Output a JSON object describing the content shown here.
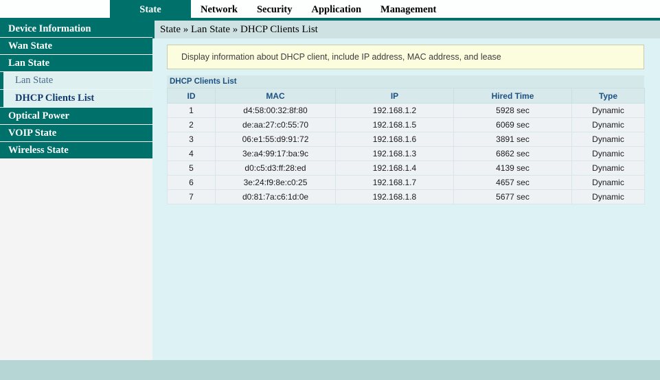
{
  "nav": {
    "items": [
      {
        "label": "State",
        "active": true
      },
      {
        "label": "Network",
        "active": false
      },
      {
        "label": "Security",
        "active": false
      },
      {
        "label": "Application",
        "active": false
      },
      {
        "label": "Management",
        "active": false
      }
    ]
  },
  "sidebar": {
    "items": [
      {
        "label": "Device Information",
        "type": "group"
      },
      {
        "label": "Wan State",
        "type": "group"
      },
      {
        "label": "Lan State",
        "type": "group"
      },
      {
        "label": "Lan State",
        "type": "sub",
        "active": false
      },
      {
        "label": "DHCP Clients List",
        "type": "sub",
        "active": true
      },
      {
        "label": "Optical Power",
        "type": "group"
      },
      {
        "label": "VOIP State",
        "type": "group"
      },
      {
        "label": "Wireless State",
        "type": "group"
      }
    ]
  },
  "breadcrumb": {
    "text": "State » Lan State » DHCP Clients List"
  },
  "notice": {
    "text": "Display information about DHCP client, include IP address, MAC address, and lease"
  },
  "panel": {
    "title": "DHCP Clients List",
    "columns": [
      "ID",
      "MAC",
      "IP",
      "Hired Time",
      "Type"
    ],
    "rows": [
      {
        "id": "1",
        "mac": "d4:58:00:32:8f:80",
        "ip": "192.168.1.2",
        "time": "5928 sec",
        "type": "Dynamic"
      },
      {
        "id": "2",
        "mac": "de:aa:27:c0:55:70",
        "ip": "192.168.1.5",
        "time": "6069 sec",
        "type": "Dynamic"
      },
      {
        "id": "3",
        "mac": "06:e1:55:d9:91:72",
        "ip": "192.168.1.6",
        "time": "3891 sec",
        "type": "Dynamic"
      },
      {
        "id": "4",
        "mac": "3e:a4:99:17:ba:9c",
        "ip": "192.168.1.3",
        "time": "6862 sec",
        "type": "Dynamic"
      },
      {
        "id": "5",
        "mac": "d0:c5:d3:ff:28:ed",
        "ip": "192.168.1.4",
        "time": "4139 sec",
        "type": "Dynamic"
      },
      {
        "id": "6",
        "mac": "3e:24:f9:8e:c0:25",
        "ip": "192.168.1.7",
        "time": "4657 sec",
        "type": "Dynamic"
      },
      {
        "id": "7",
        "mac": "d0:81:7a:c6:1d:0e",
        "ip": "192.168.1.8",
        "time": "5677 sec",
        "type": "Dynamic"
      }
    ]
  },
  "colors": {
    "teal": "#00706b",
    "content_bg": "#ddf2f4",
    "notice_bg": "#fcfcdf",
    "header_text": "#1c4f80",
    "footer_bg": "#b6d6d6"
  }
}
